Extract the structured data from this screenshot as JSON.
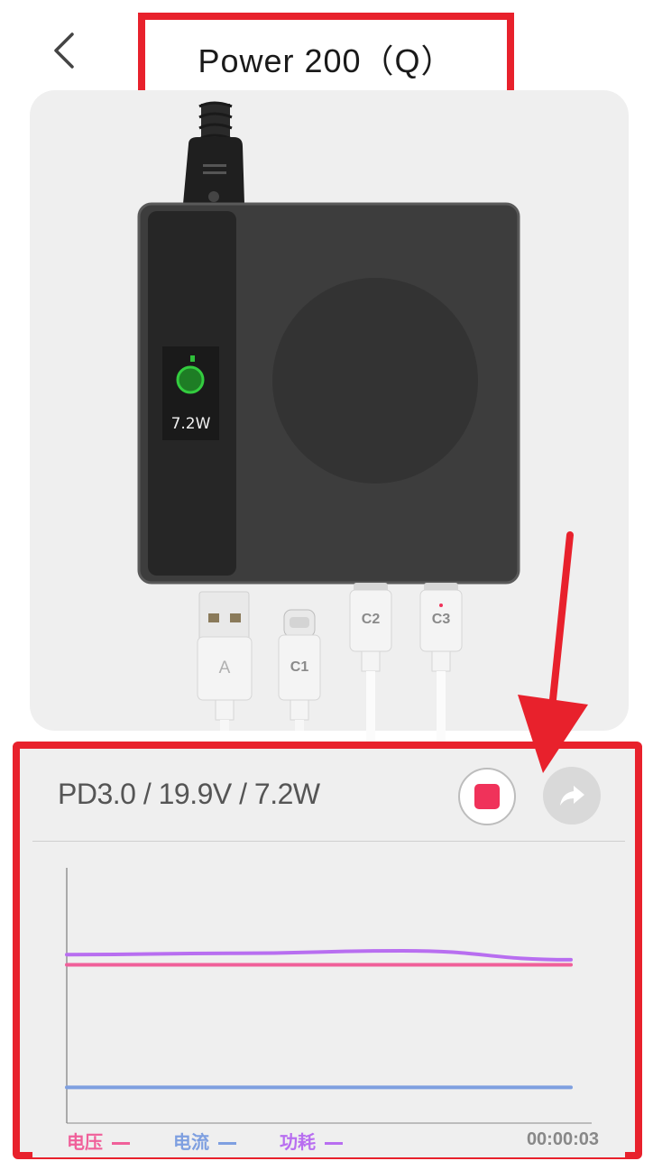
{
  "header": {
    "title": "Power 200（Q）",
    "back_icon": "chevron-left-icon"
  },
  "device": {
    "display_power": "7.2W",
    "ports": [
      {
        "label": "A",
        "type": "usb-a"
      },
      {
        "label": "C1",
        "type": "usb-c"
      },
      {
        "label": "C2",
        "type": "usb-c"
      },
      {
        "label": "C3",
        "type": "usb-c",
        "active": true
      }
    ]
  },
  "panel": {
    "protocol_info": "PD3.0 / 19.9V / 7.2W",
    "stop_icon": "stop-record-icon",
    "share_icon": "share-icon",
    "legend": {
      "voltage": "电压",
      "current": "电流",
      "power": "功耗"
    },
    "elapsed_time": "00:00:03"
  },
  "colors": {
    "accent_red": "#e8212c",
    "voltage": "#f0609a",
    "current": "#7e9fe0",
    "power": "#b86ef0",
    "record": "#f0325a"
  },
  "chart_data": {
    "type": "line",
    "title": "",
    "xlabel": "",
    "ylabel": "",
    "x": [
      0,
      1,
      2,
      3
    ],
    "series": [
      {
        "name": "电压",
        "values": [
          0.62,
          0.62,
          0.62,
          0.62
        ]
      },
      {
        "name": "电流",
        "values": [
          0.14,
          0.14,
          0.14,
          0.14
        ]
      },
      {
        "name": "功耗",
        "values": [
          0.66,
          0.665,
          0.675,
          0.64
        ]
      }
    ],
    "ylim": [
      0,
      1
    ],
    "grid": false,
    "legend": "bottom-left"
  }
}
